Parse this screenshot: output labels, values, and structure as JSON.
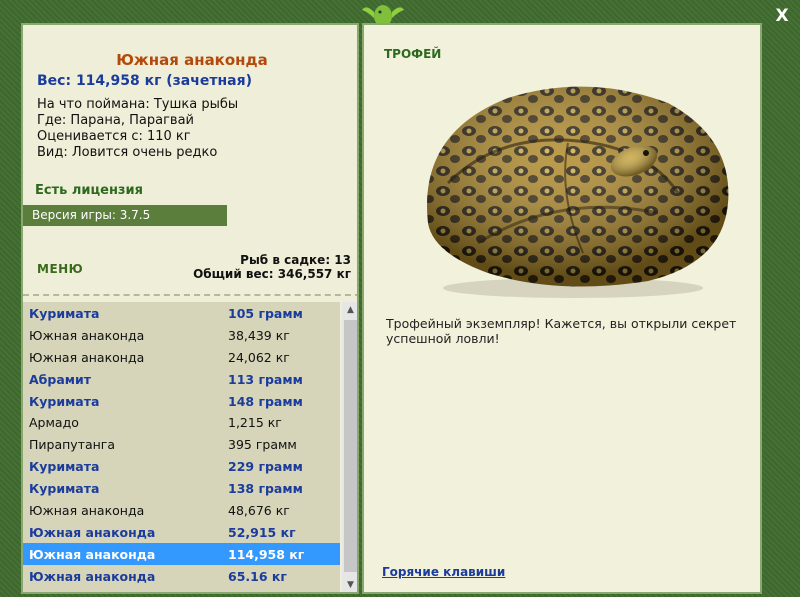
{
  "window": {
    "close_label": "X"
  },
  "fish": {
    "name": "Южная анаконда",
    "weight": "Вес: 114,958 кг (зачетная)",
    "caught_on": "На что поймана: Тушка рыбы",
    "location": "Где: Парана, Парагвай",
    "rated_from": "Оценивается с: 110 кг",
    "type": "Вид: Ловится очень редко"
  },
  "license": "Есть лицензия",
  "version": "Версия игры: 3.7.5",
  "menu_label": "МЕНЮ",
  "keepnet": {
    "count": "Рыб в садке: 13",
    "total": "Общий вес: 346,557 кг"
  },
  "catch_list": [
    {
      "name": "Куримата",
      "weight": "105 грамм",
      "bold": true
    },
    {
      "name": "Южная анаконда",
      "weight": "38,439 кг",
      "bold": false
    },
    {
      "name": "Южная анаконда",
      "weight": "24,062 кг",
      "bold": false
    },
    {
      "name": "Абрамит",
      "weight": "113 грамм",
      "bold": true
    },
    {
      "name": "Куримата",
      "weight": "148 грамм",
      "bold": true
    },
    {
      "name": "Армадо",
      "weight": "1,215 кг",
      "bold": false
    },
    {
      "name": "Пирапутанга",
      "weight": "395 грамм",
      "bold": false
    },
    {
      "name": "Куримата",
      "weight": "229 грамм",
      "bold": true
    },
    {
      "name": "Куримата",
      "weight": "138 грамм",
      "bold": true
    },
    {
      "name": "Южная анаконда",
      "weight": "48,676 кг",
      "bold": false
    },
    {
      "name": "Южная анаконда",
      "weight": "52,915 кг",
      "bold": true
    },
    {
      "name": "Южная анаконда",
      "weight": "114,958 кг",
      "bold": true,
      "selected": true
    },
    {
      "name": "Южная анаконда",
      "weight": "65.16 кг",
      "bold": true
    }
  ],
  "trophy_label": "ТРОФЕЙ",
  "trophy_text": "Трофейный экземпляр! Кажется, вы открыли секрет успешной ловли!",
  "hotkeys": "Горячие клавиши",
  "icons": [
    "lizard-logo-icon",
    "close-icon",
    "scroll-up-icon",
    "scroll-down-icon"
  ]
}
